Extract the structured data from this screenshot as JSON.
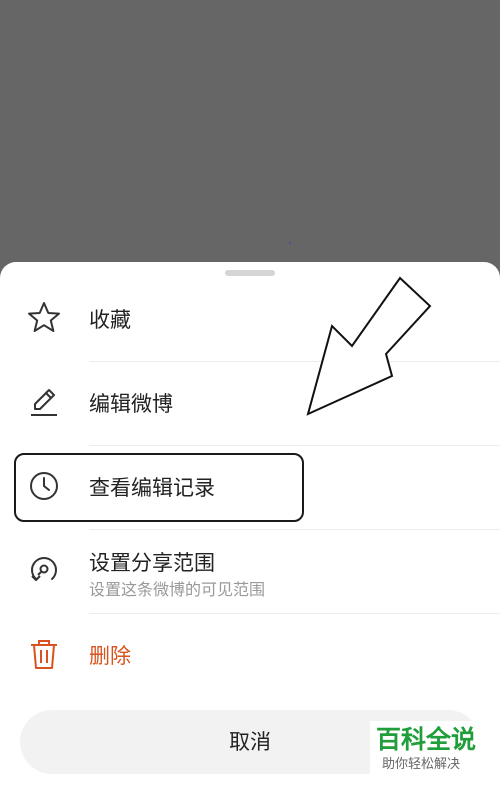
{
  "menu": {
    "items": [
      {
        "label": "收藏",
        "icon": "star-icon"
      },
      {
        "label": "编辑微博",
        "icon": "pencil-icon"
      },
      {
        "label": "查看编辑记录",
        "icon": "clock-icon"
      },
      {
        "label": "设置分享范围",
        "sublabel": "设置这条微博的可见范围",
        "icon": "share-scope-icon"
      },
      {
        "label": "删除",
        "icon": "trash-icon"
      }
    ],
    "cancel_label": "取消"
  },
  "colors": {
    "overlay": "#666666",
    "danger": "#d9531e",
    "watermark": "#1f9e3a"
  },
  "watermark": {
    "title": "百科全说",
    "subtitle": "助你轻松解决"
  }
}
